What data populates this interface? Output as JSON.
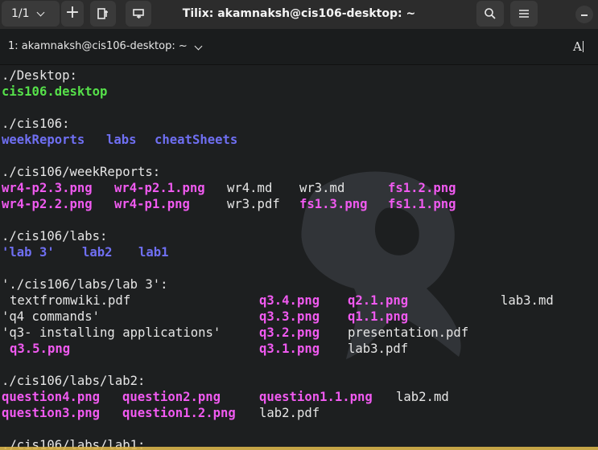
{
  "header": {
    "session_count": "1/1",
    "title": "Tilix: akamnaksh@cis106-desktop: ~"
  },
  "session": {
    "title": "1: akamnaksh@cis106-desktop: ~",
    "readonly_glyph": "A"
  },
  "terminal": {
    "lines": [
      {
        "row": 0,
        "tokens": [
          {
            "c": 0,
            "t": "./Desktop:",
            "k": "plain"
          }
        ]
      },
      {
        "row": 1,
        "tokens": [
          {
            "c": 0,
            "t": "cis106.desktop",
            "k": "exe"
          }
        ]
      },
      {
        "row": 3,
        "tokens": [
          {
            "c": 0,
            "t": "./cis106:",
            "k": "plain"
          }
        ]
      },
      {
        "row": 4,
        "tokens": [
          {
            "c": 0,
            "t": "weekReports",
            "k": "dir"
          },
          {
            "c": 13,
            "t": "labs",
            "k": "dir"
          },
          {
            "c": 19,
            "t": "cheatSheets",
            "k": "dir"
          }
        ]
      },
      {
        "row": 6,
        "tokens": [
          {
            "c": 0,
            "t": "./cis106/weekReports:",
            "k": "plain"
          }
        ]
      },
      {
        "row": 7,
        "tokens": [
          {
            "c": 0,
            "t": "wr4-p2.3.png",
            "k": "img"
          },
          {
            "c": 14,
            "t": "wr4-p2.1.png",
            "k": "img"
          },
          {
            "c": 28,
            "t": "wr4.md",
            "k": "plain"
          },
          {
            "c": 37,
            "t": "wr3.md",
            "k": "plain"
          },
          {
            "c": 48,
            "t": "fs1.2.png",
            "k": "img"
          }
        ]
      },
      {
        "row": 8,
        "tokens": [
          {
            "c": 0,
            "t": "wr4-p2.2.png",
            "k": "img"
          },
          {
            "c": 14,
            "t": "wr4-p1.png",
            "k": "img"
          },
          {
            "c": 28,
            "t": "wr3.pdf",
            "k": "plain"
          },
          {
            "c": 37,
            "t": "fs1.3.png",
            "k": "img"
          },
          {
            "c": 48,
            "t": "fs1.1.png",
            "k": "img"
          }
        ]
      },
      {
        "row": 10,
        "tokens": [
          {
            "c": 0,
            "t": "./cis106/labs:",
            "k": "plain"
          }
        ]
      },
      {
        "row": 11,
        "tokens": [
          {
            "c": 0,
            "t": "'lab 3'",
            "k": "dir"
          },
          {
            "c": 10,
            "t": "lab2",
            "k": "dir"
          },
          {
            "c": 17,
            "t": "lab1",
            "k": "dir"
          }
        ]
      },
      {
        "row": 13,
        "tokens": [
          {
            "c": 0,
            "t": "'./cis106/labs/lab 3':",
            "k": "plain"
          }
        ]
      },
      {
        "row": 14,
        "tokens": [
          {
            "c": 1,
            "t": "textfromwiki.pdf",
            "k": "plain"
          },
          {
            "c": 32,
            "t": "q3.4.png",
            "k": "img"
          },
          {
            "c": 43,
            "t": "q2.1.png",
            "k": "img"
          },
          {
            "c": 62,
            "t": "lab3.md",
            "k": "plain"
          }
        ]
      },
      {
        "row": 15,
        "tokens": [
          {
            "c": 0,
            "t": "'q4 commands'",
            "k": "plain"
          },
          {
            "c": 32,
            "t": "q3.3.png",
            "k": "img"
          },
          {
            "c": 43,
            "t": "q1.1.png",
            "k": "img"
          }
        ]
      },
      {
        "row": 16,
        "tokens": [
          {
            "c": 0,
            "t": "'q3- installing applications'",
            "k": "plain"
          },
          {
            "c": 32,
            "t": "q3.2.png",
            "k": "img"
          },
          {
            "c": 43,
            "t": "presentation.pdf",
            "k": "plain"
          }
        ]
      },
      {
        "row": 17,
        "tokens": [
          {
            "c": 1,
            "t": "q3.5.png",
            "k": "img"
          },
          {
            "c": 32,
            "t": "q3.1.png",
            "k": "img"
          },
          {
            "c": 43,
            "t": "lab3.pdf",
            "k": "plain"
          }
        ]
      },
      {
        "row": 19,
        "tokens": [
          {
            "c": 0,
            "t": "./cis106/labs/lab2:",
            "k": "plain"
          }
        ]
      },
      {
        "row": 20,
        "tokens": [
          {
            "c": 0,
            "t": "question4.png",
            "k": "img"
          },
          {
            "c": 15,
            "t": "question2.png",
            "k": "img"
          },
          {
            "c": 32,
            "t": "question1.1.png",
            "k": "img"
          },
          {
            "c": 49,
            "t": "lab2.md",
            "k": "plain"
          }
        ]
      },
      {
        "row": 21,
        "tokens": [
          {
            "c": 0,
            "t": "question3.png",
            "k": "img"
          },
          {
            "c": 15,
            "t": "question1.2.png",
            "k": "img"
          },
          {
            "c": 32,
            "t": "lab2.pdf",
            "k": "plain"
          }
        ]
      },
      {
        "row": 23,
        "tokens": [
          {
            "c": 0,
            "t": "./cis106/labs/lab1:",
            "k": "plain"
          }
        ]
      }
    ]
  },
  "colors": {
    "directory": "#6f6ff2",
    "image_file": "#f05af0",
    "executable": "#56e04a",
    "plain_text": "#e6e6e6",
    "background": "#1d1f20"
  },
  "icons": {
    "session_switcher": "chevron-down-icon",
    "add_terminal": "plus-icon",
    "add_right": "split-right-icon",
    "add_down": "split-down-icon",
    "search": "search-icon",
    "menu": "hamburger-icon",
    "minimize": "minimize-icon",
    "readonly": "text-cursor-icon"
  }
}
